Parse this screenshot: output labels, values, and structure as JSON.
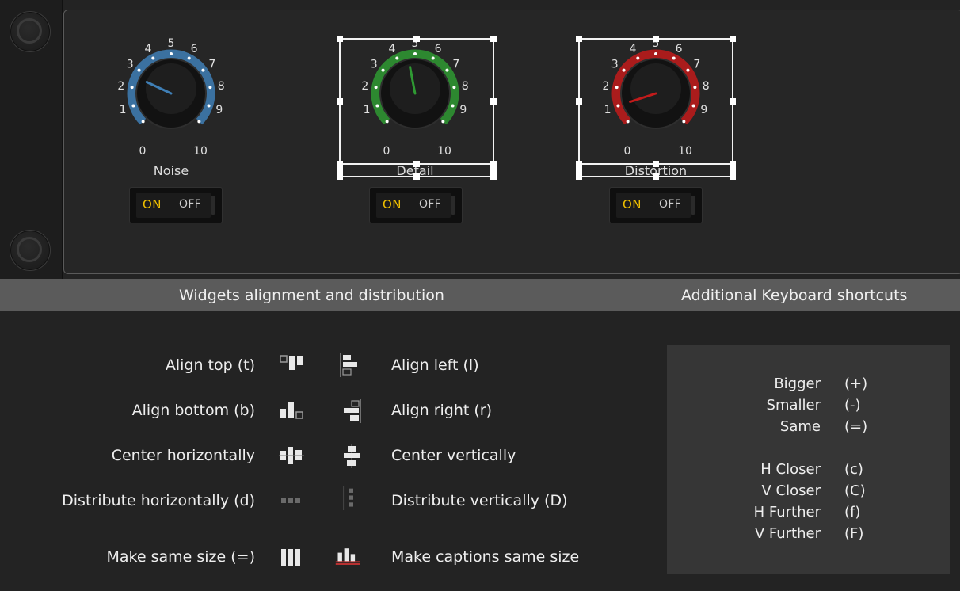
{
  "knobs": [
    {
      "caption": "Noise",
      "color": "#3f7fb6",
      "ticks": [
        "0",
        "1",
        "2",
        "3",
        "4",
        "5",
        "6",
        "7",
        "8",
        "9",
        "10"
      ],
      "value": 2.6
    },
    {
      "caption": "Detail",
      "color": "#2f9a33",
      "ticks": [
        "0",
        "1",
        "2",
        "3",
        "4",
        "5",
        "6",
        "7",
        "8",
        "9",
        "10"
      ],
      "value": 4.6
    },
    {
      "caption": "Distortion",
      "color": "#c21b1b",
      "ticks": [
        "0",
        "1",
        "2",
        "3",
        "4",
        "5",
        "6",
        "7",
        "8",
        "9",
        "10"
      ],
      "value": 1.0
    }
  ],
  "toggles": [
    {
      "on": "ON",
      "off": "OFF"
    },
    {
      "on": "ON",
      "off": "OFF"
    },
    {
      "on": "ON",
      "off": "OFF"
    }
  ],
  "section": {
    "alignment_title": "Widgets alignment and distribution",
    "shortcuts_title": "Additional Keyboard shortcuts"
  },
  "align": {
    "top": "Align top (t)",
    "bottom": "Align bottom (b)",
    "center_h": "Center horizontally",
    "distribute_h": "Distribute horizontally (d)",
    "same_size": "Make same size (=)",
    "left": "Align left (l)",
    "right": "Align right (r)",
    "center_v": "Center vertically",
    "distribute_v": "Distribute vertically (D)",
    "captions_same": "Make captions same size"
  },
  "shortcuts": [
    {
      "label": "Bigger",
      "key": "(+)"
    },
    {
      "label": "Smaller",
      "key": "(-)"
    },
    {
      "label": "Same",
      "key": "(=)"
    },
    {
      "label": "H Closer",
      "key": "(c)"
    },
    {
      "label": "V Closer",
      "key": "(C)"
    },
    {
      "label": "H Further",
      "key": "(f)"
    },
    {
      "label": "V Further",
      "key": "(F)"
    }
  ],
  "colors": {
    "toggle_on": "#f0c000",
    "header": "#5b5b5b"
  }
}
